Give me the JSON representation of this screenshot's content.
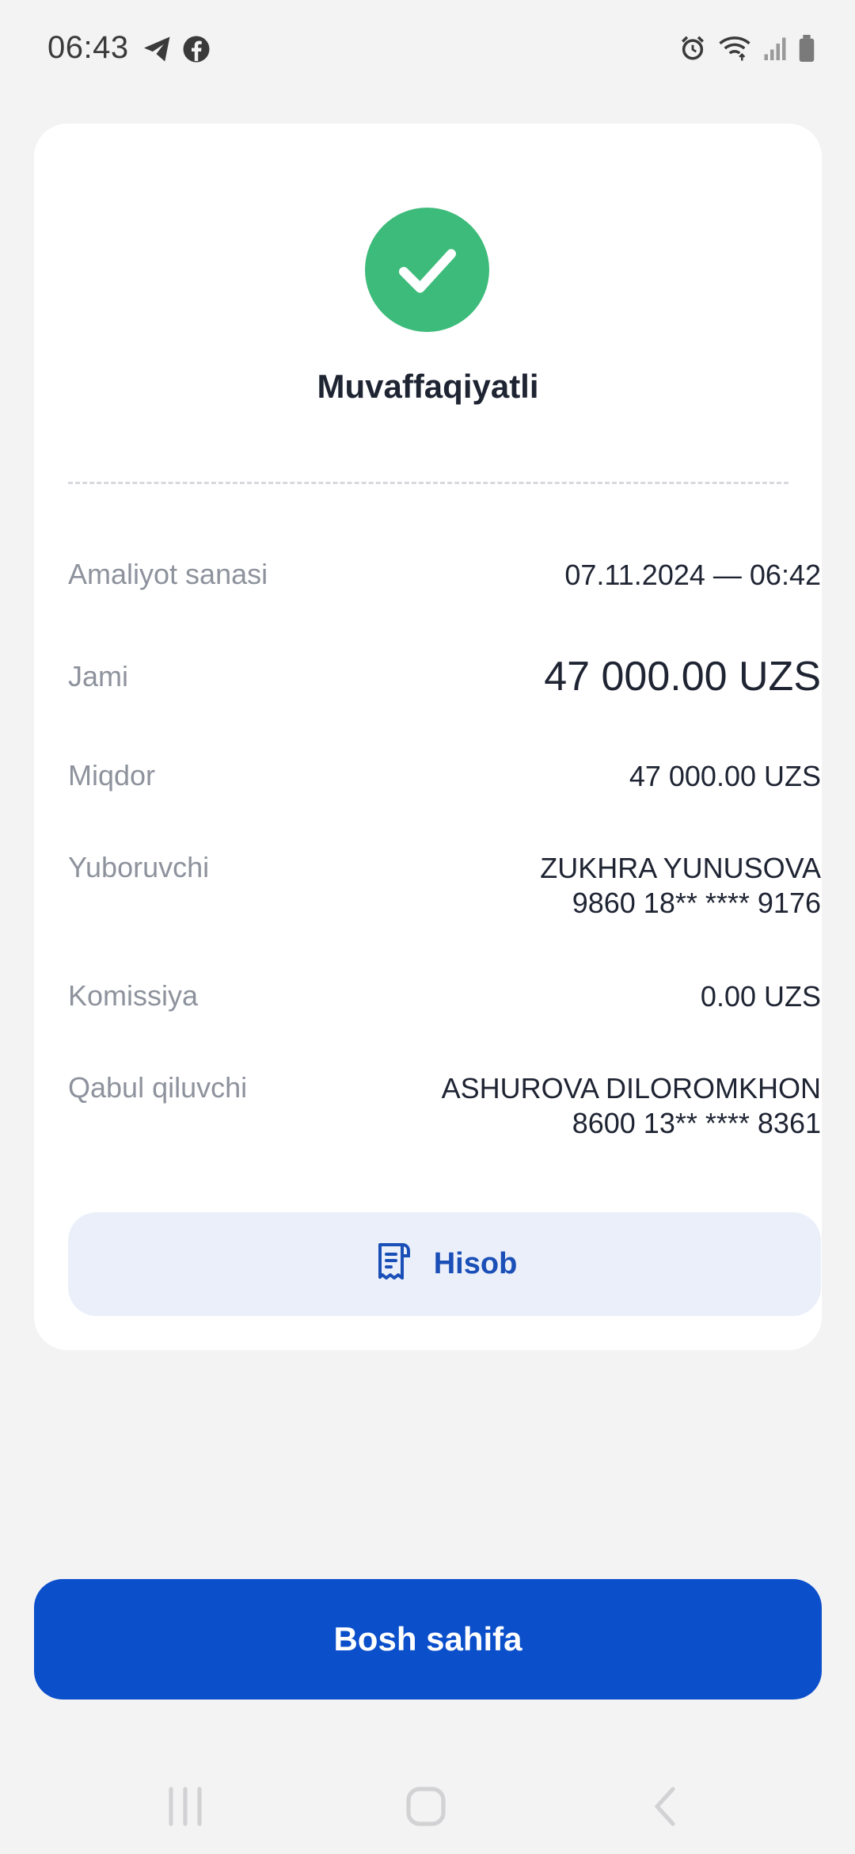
{
  "status_bar": {
    "time": "06:43",
    "left_icons": [
      "telegram-icon",
      "facebook-icon"
    ],
    "right_icons": [
      "alarm-icon",
      "wifi-icon",
      "signal-icon",
      "battery-icon"
    ]
  },
  "result": {
    "title": "Muvaffaqiyatli",
    "icon": "check-icon",
    "success_color": "#3dbb7a"
  },
  "details": {
    "date_label": "Amaliyot sanasi",
    "date_value": "07.11.2024 — 06:42",
    "total_label": "Jami",
    "total_value": "47 000.00 UZS",
    "amount_label": "Miqdor",
    "amount_value": "47 000.00 UZS",
    "sender_label": "Yuboruvchi",
    "sender_name": "ZUKHRA YUNUSOVA",
    "sender_card": "9860 18** **** 9176",
    "fee_label": "Komissiya",
    "fee_value": "0.00 UZS",
    "receiver_label": "Qabul qiluvchi",
    "receiver_name": "ASHUROVA DILOROMKHON",
    "receiver_card": "8600 13** **** 8361"
  },
  "actions": {
    "receipt_label": "Hisob",
    "receipt_icon": "receipt-icon",
    "home_label": "Bosh sahifa",
    "accent_color": "#0b4fcb"
  },
  "nav_bar": {
    "items": [
      "recent-apps-icon",
      "home-icon",
      "back-icon"
    ]
  }
}
